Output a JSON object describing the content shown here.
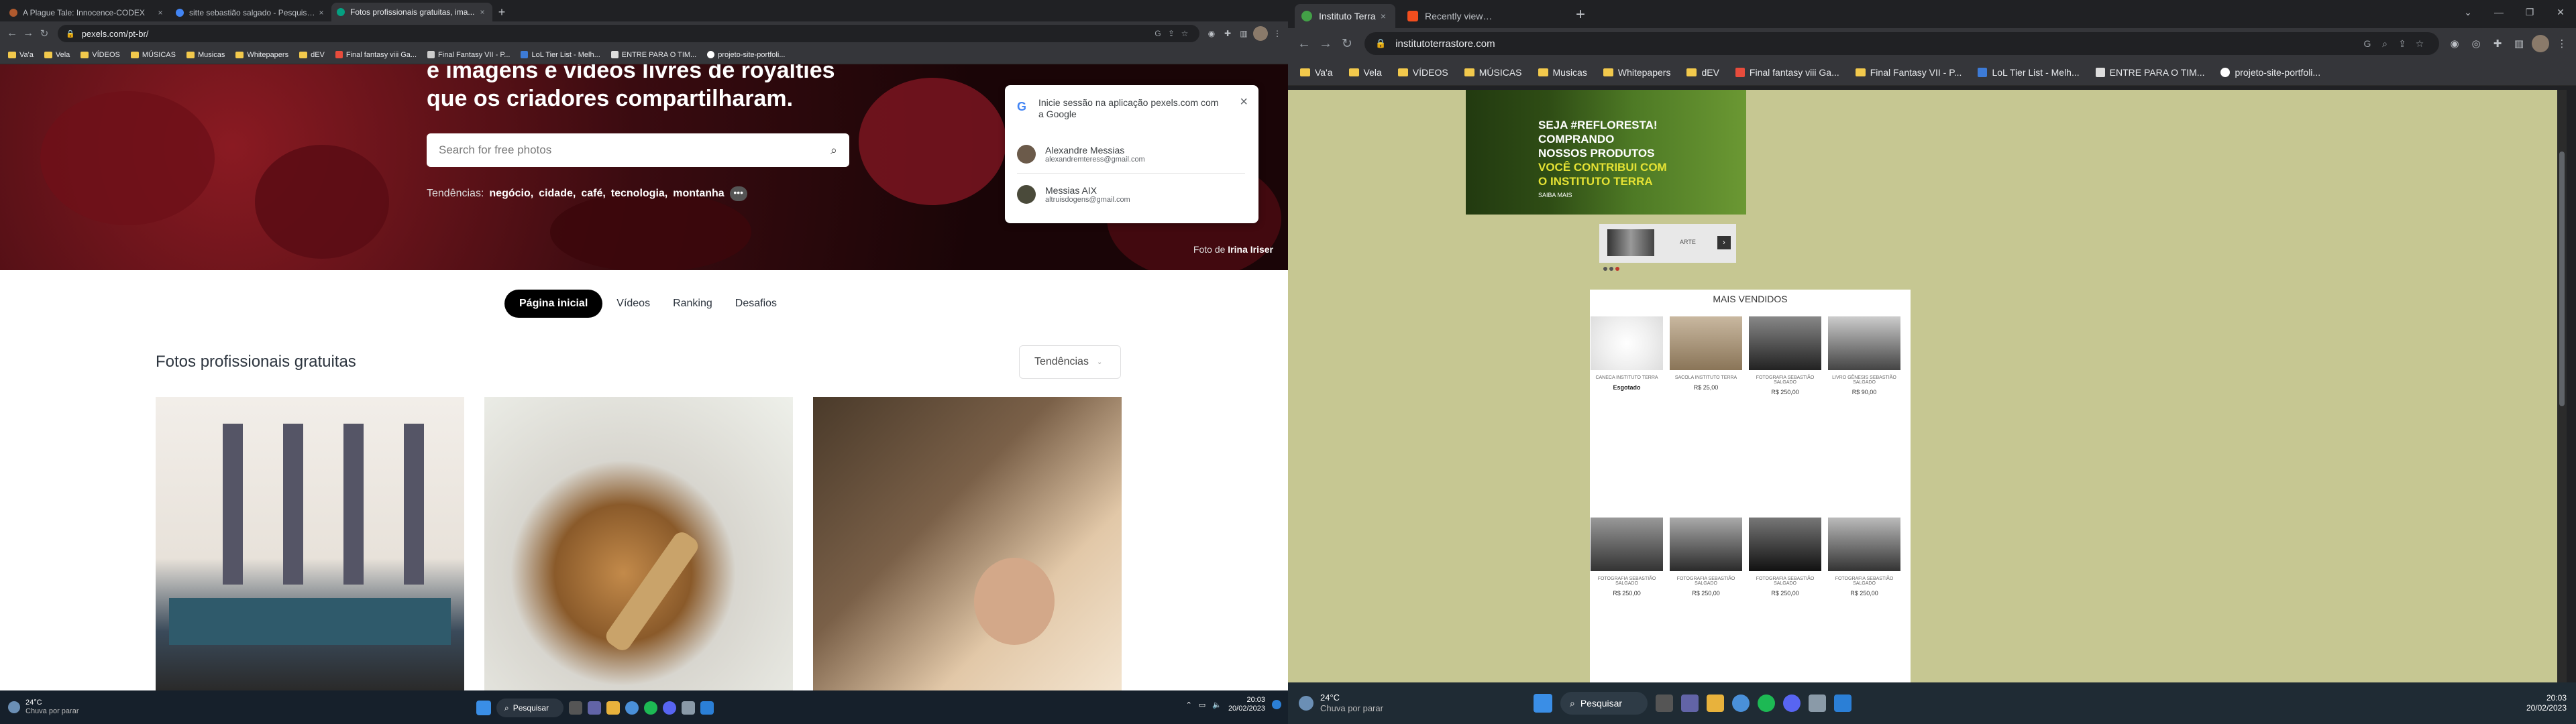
{
  "left": {
    "tabs": [
      {
        "title": "A Plague Tale: Innocence-CODEX",
        "active": false,
        "fav": "#b05a2e"
      },
      {
        "title": "sitte sebastião salgado - Pesquisa...",
        "active": false,
        "fav": "#4285f4"
      },
      {
        "title": "Fotos profissionais gratuitas, ima...",
        "active": true,
        "fav": "#05a081"
      }
    ],
    "url": "pexels.com/pt-br/",
    "bookmarks": [
      "Va'a",
      "Vela",
      "VÍDEOS",
      "MÚSICAS",
      "Musicas",
      "Whitepapers",
      "dEV",
      "Final fantasy viii Ga...",
      "Final Fantasy VII - P...",
      "LoL Tier List - Melh...",
      "ENTRE PARA O TIM...",
      "projeto-site-portfoli..."
    ],
    "hero": {
      "title": "e imagens e vídeos livres de royalties que os criadores compartilharam.",
      "search_placeholder": "Search for free photos",
      "trends_label": "Tendências:",
      "trends": [
        "negócio,",
        "cidade,",
        "café,",
        "tecnologia,",
        "montanha"
      ],
      "more": "•••",
      "credit_prefix": "Foto de",
      "credit_name": "Irina Iriser"
    },
    "google_popup": {
      "title": "Inicie sessão na aplicação pexels.com com a Google",
      "accounts": [
        {
          "name": "Alexandre Messias",
          "email": "alexandremteress@gmail.com"
        },
        {
          "name": "Messias AIX",
          "email": "altruisdogens@gmail.com"
        }
      ]
    },
    "nav": [
      "Página inicial",
      "Vídeos",
      "Ranking",
      "Desafios"
    ],
    "section_title": "Fotos profissionais gratuitas",
    "sort": "Tendências",
    "taskbar": {
      "temp": "24°C",
      "weather": "Chuva por parar",
      "search": "Pesquisar",
      "time": "20:03",
      "date": "20/02/2023"
    }
  },
  "right": {
    "tabs": [
      {
        "title": "Instituto Terra",
        "active": true,
        "fav": "#43a047"
      },
      {
        "title": "Recently viewed – Figma",
        "active": false,
        "fav": "#f24e1e"
      }
    ],
    "url": "institutoterrastore.com",
    "bookmarks": [
      "Va'a",
      "Vela",
      "VÍDEOS",
      "MÚSICAS",
      "Musicas",
      "Whitepapers",
      "dEV",
      "Final fantasy viii Ga...",
      "Final Fantasy VII - P...",
      "LoL Tier List - Melh...",
      "ENTRE PARA O TIM...",
      "projeto-site-portfoli..."
    ],
    "banner": {
      "line1": "SEJA #REFLORESTA!",
      "line2": "COMPRANDO",
      "line3": "NOSSOS PRODUTOS",
      "line4": "VOCÊ CONTRIBUI COM",
      "line5": "O INSTITUTO TERRA",
      "link": "SAIBA MAIS"
    },
    "carousel_label": "ARTE",
    "store_title": "MAIS VENDIDOS",
    "products": [
      {
        "name": "CANECA INSTITUTO TERRA",
        "price": "Esgotado"
      },
      {
        "name": "SACOLA INSTITUTO TERRA",
        "price": "R$ 25,00"
      },
      {
        "name": "FOTOGRAFIA SEBASTIÃO SALGADO",
        "price": "R$ 250,00"
      },
      {
        "name": "LIVRO GÊNESIS SEBASTIÃO SALGADO",
        "price": "R$ 90,00"
      },
      {
        "name": "FOTOGRAFIA SEBASTIÃO SALGADO",
        "price": "R$ 250,00"
      },
      {
        "name": "FOTOGRAFIA SEBASTIÃO SALGADO",
        "price": "R$ 250,00"
      },
      {
        "name": "FOTOGRAFIA SEBASTIÃO SALGADO",
        "price": "R$ 250,00"
      },
      {
        "name": "FOTOGRAFIA SEBASTIÃO SALGADO",
        "price": "R$ 250,00"
      }
    ],
    "taskbar": {
      "temp": "24°C",
      "weather": "Chuva por parar",
      "search": "Pesquisar",
      "time": "20:03",
      "date": "20/02/2023"
    }
  },
  "colors": {
    "chrome_dark": "#202124",
    "chrome_mid": "#35363a",
    "pexels_green": "#05a081",
    "terra_olive": "#c6c792",
    "taskbar_left": "#16202b",
    "taskbar_right": "#1f2b34"
  }
}
